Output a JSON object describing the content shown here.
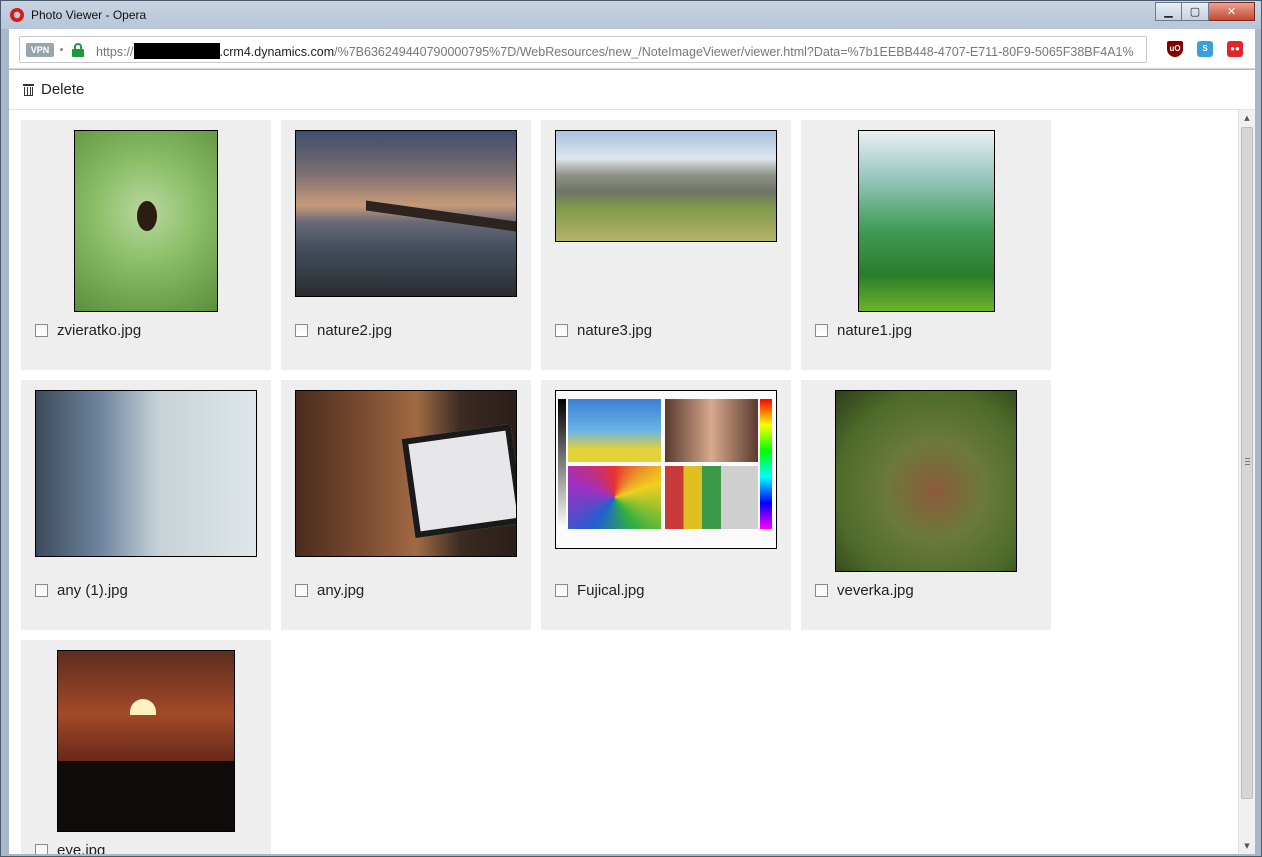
{
  "window": {
    "title": "Photo Viewer - Opera",
    "controls": {
      "minimize": "▁",
      "maximize": "▢",
      "close": "✕"
    }
  },
  "addressbar": {
    "vpn_label": "VPN",
    "url_prefix": "https://",
    "url_host": ".crm4.dynamics.com",
    "url_path": "/%7B636249440790000795%7D/WebResources/new_/NoteImageViewer/viewer.html?Data=%7b1EEBB448-4707-E711-80F9-5065F38BF4A1%",
    "extensions": [
      "ublock-icon",
      "skype-icon",
      "extension-icon"
    ],
    "extension_labels": [
      "uO",
      "S",
      "●●"
    ]
  },
  "toolbar": {
    "delete_label": "Delete",
    "delete_icon": "trash-icon"
  },
  "gallery": {
    "items": [
      {
        "filename": "zvieratko.jpg",
        "image": "spider",
        "checked": false
      },
      {
        "filename": "nature2.jpg",
        "image": "pier",
        "checked": false
      },
      {
        "filename": "nature3.jpg",
        "image": "mountain",
        "checked": false
      },
      {
        "filename": "nature1.jpg",
        "image": "valley",
        "checked": false
      },
      {
        "filename": "any (1).jpg",
        "image": "woman",
        "checked": false
      },
      {
        "filename": "any.jpg",
        "image": "tablet",
        "checked": false
      },
      {
        "filename": "Fujical.jpg",
        "image": "test-chart",
        "checked": false
      },
      {
        "filename": "veverka.jpg",
        "image": "squirrel",
        "checked": false
      },
      {
        "filename": "eye.jpg",
        "image": "london-eye",
        "checked": false
      }
    ]
  },
  "scrollbar": {
    "up_arrow": "▲",
    "down_arrow": "▼"
  }
}
